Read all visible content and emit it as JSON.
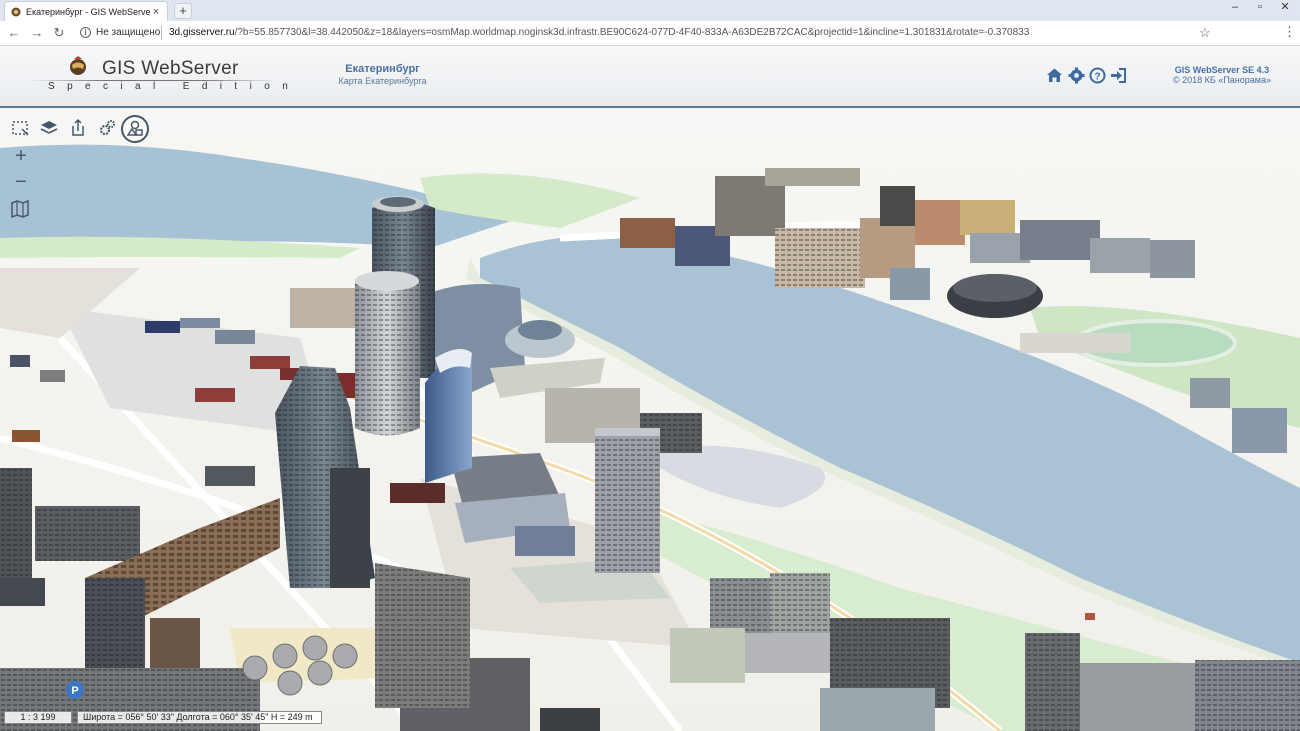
{
  "browser": {
    "tab_title": "Екатеринбург - GIS WebServer S",
    "tab_close": "×",
    "new_tab": "+",
    "security_label": "Не защищено",
    "url_host": "3d.gisserver.ru",
    "url_rest": "/?b=55.857730&l=38.442050&z=18&layers=osmMap.worldmap.noginsk3d.infrastr.BE90C624-077D-4F40-833A-A63DE2B72CAC&projectid=1&incline=1.301831&rotate=-0.370833"
  },
  "header": {
    "product_name": "GIS WebServer",
    "product_edition": "Special Edition",
    "city_title": "Екатеринбург",
    "map_subtitle": "Карта Екатеринбурга",
    "version": "GIS WebServer SE 4.3",
    "copyright": "© 2018 КБ «Панорама»",
    "icons": [
      "home-icon",
      "settings-gear-icon",
      "help-icon",
      "login-icon"
    ]
  },
  "toolbar": {
    "tools": [
      "select-area-icon",
      "layers-icon",
      "export-icon",
      "settings-icon",
      "objects-icon"
    ],
    "zoom_in": "+",
    "zoom_out": "−",
    "map_mode_icon": "map-icon"
  },
  "status": {
    "scale": "1 : 3 199",
    "coordinates": "Широта = 056° 50' 33\" Долгота = 060° 35' 45\" H = 249 m"
  },
  "colors": {
    "header_accent": "#4a6fa0",
    "header_border": "#5f7894",
    "water": "#a8c3d6",
    "park": "#cfe8c8",
    "ground": "#f1efe9"
  }
}
